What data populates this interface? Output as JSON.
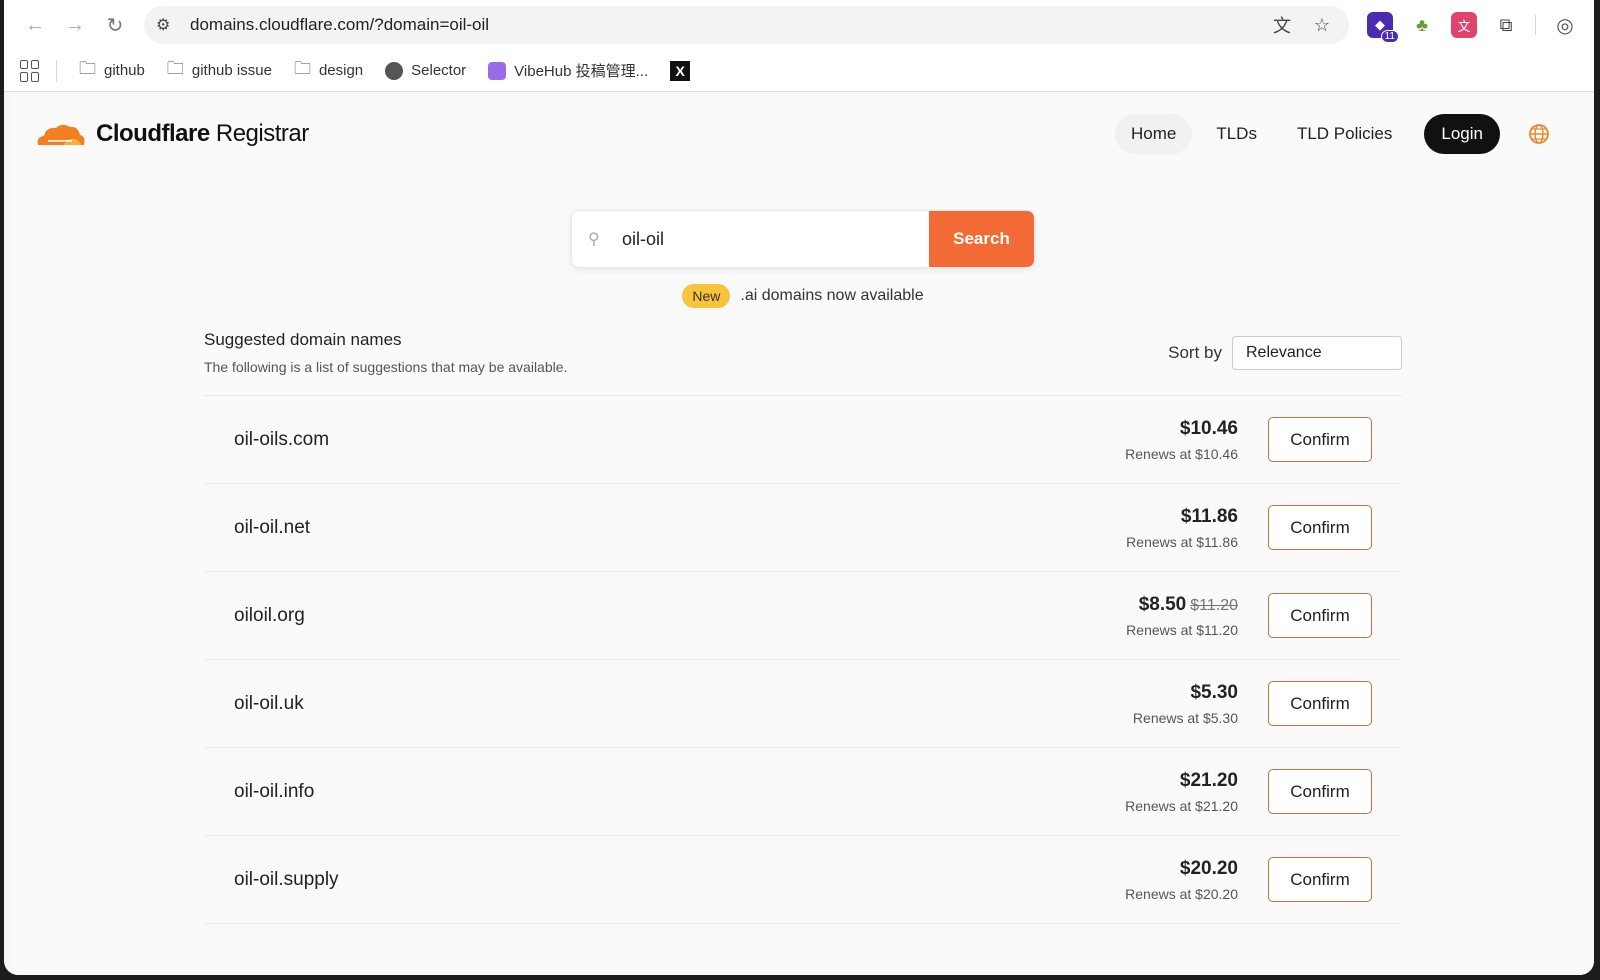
{
  "browser": {
    "url": "domains.cloudflare.com/?domain=oil-oil",
    "extension_badge": "11",
    "bookmarks": [
      {
        "label": "github"
      },
      {
        "label": "github issue"
      },
      {
        "label": "design"
      },
      {
        "label": "Selector"
      },
      {
        "label": "VibeHub 投稿管理..."
      }
    ]
  },
  "site": {
    "logo_bold": "Cloudflare",
    "logo_light": " Registrar",
    "nav": {
      "home": "Home",
      "tlds": "TLDs",
      "tld_policies": "TLD Policies",
      "login": "Login"
    }
  },
  "search": {
    "value": "oil-oil",
    "button": "Search"
  },
  "announcement": {
    "badge": "New",
    "text": ".ai domains now available"
  },
  "results": {
    "title": "Suggested domain names",
    "subtitle": "The following is a list of suggestions that may be available.",
    "sort_label": "Sort by",
    "sort_value": "Relevance",
    "confirm_label": "Confirm",
    "items": [
      {
        "domain": "oil-oils.com",
        "price": "$10.46",
        "old_price": "",
        "renews": "Renews at $10.46"
      },
      {
        "domain": "oil-oil.net",
        "price": "$11.86",
        "old_price": "",
        "renews": "Renews at $11.86"
      },
      {
        "domain": "oiloil.org",
        "price": "$8.50",
        "old_price": "$11.20",
        "renews": "Renews at $11.20"
      },
      {
        "domain": "oil-oil.uk",
        "price": "$5.30",
        "old_price": "",
        "renews": "Renews at $5.30"
      },
      {
        "domain": "oil-oil.info",
        "price": "$21.20",
        "old_price": "",
        "renews": "Renews at $21.20"
      },
      {
        "domain": "oil-oil.supply",
        "price": "$20.20",
        "old_price": "",
        "renews": "Renews at $20.20"
      }
    ]
  },
  "colors": {
    "accent": "#f36b34",
    "badge": "#f9c33c",
    "confirm_border": "#c8733f"
  }
}
